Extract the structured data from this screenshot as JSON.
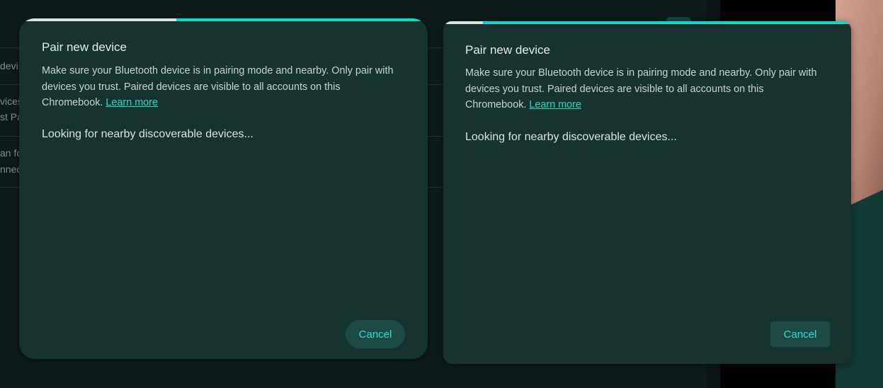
{
  "background": {
    "row_fragments": [
      "devi",
      "vices",
      "st Pa",
      "an fo",
      "nnec"
    ]
  },
  "dialogs": [
    {
      "title": "Pair new device",
      "description": "Make sure your Bluetooth device is in pairing mode and nearby. Only pair with devices you trust. Paired devices are visible to all accounts on this Chromebook.",
      "learn_more": "Learn more",
      "status": "Looking for nearby discoverable devices...",
      "cancel_label": "Cancel",
      "progress_fraction": 0.385
    },
    {
      "title": "Pair new device",
      "description": "Make sure your Bluetooth device is in pairing mode and nearby. Only pair with devices you trust. Paired devices are visible to all accounts on this Chromebook.",
      "learn_more": "Learn more",
      "status": "Looking for nearby discoverable devices...",
      "cancel_label": "Cancel",
      "progress_fraction": 0.097
    }
  ],
  "colors": {
    "accent": "#00dcc5",
    "dialog_bg": "#17332f",
    "button_bg": "#1e4a45"
  }
}
